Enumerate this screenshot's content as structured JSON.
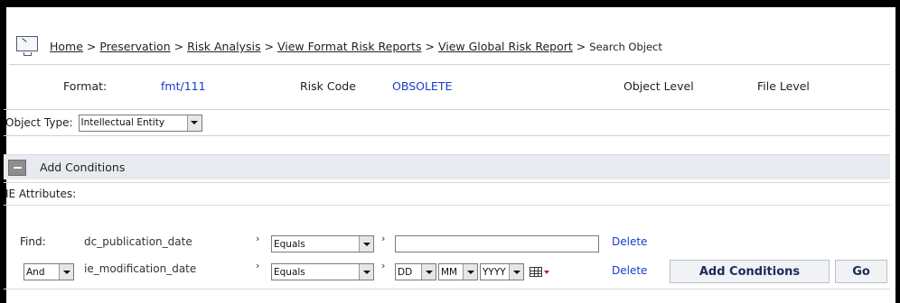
{
  "breadcrumb": {
    "items": [
      {
        "label": "Home",
        "link": true
      },
      {
        "label": "Preservation",
        "link": true
      },
      {
        "label": "Risk Analysis",
        "link": true
      },
      {
        "label": "View Format Risk Reports",
        "link": true
      },
      {
        "label": "View Global Risk Report",
        "link": true
      },
      {
        "label": "Search Object",
        "link": false
      }
    ],
    "separator": ">"
  },
  "info": {
    "format_label": "Format:",
    "format_value": "fmt/111",
    "risk_code_label": "Risk Code",
    "risk_code_value": "OBSOLETE",
    "object_level_label": "Object Level",
    "object_level_value": "File Level"
  },
  "object_type": {
    "label": "Object Type:",
    "selected": "Intellectual Entity"
  },
  "conditions": {
    "title": "Add Conditions",
    "ie_attributes_label": "IE Attributes:",
    "find_label": "Find:",
    "rows": [
      {
        "field": "dc_publication_date",
        "operator": "Equals",
        "value": "",
        "delete_label": "Delete"
      },
      {
        "connector": "And",
        "field": "ie_modification_date",
        "operator": "Equals",
        "day": "DD",
        "month": "MM",
        "year": "YYYY",
        "delete_label": "Delete"
      }
    ],
    "add_button": "Add Conditions",
    "go_button": "Go"
  },
  "colors": {
    "link_value": "#1a3ccc",
    "header_bg": "#e7ebef",
    "button_text": "#1a2c5a"
  },
  "icons": {
    "breadcrumb_icon": "monitor-icon",
    "collapse_icon": "minus-icon",
    "calendar_icon": "calendar-icon"
  }
}
